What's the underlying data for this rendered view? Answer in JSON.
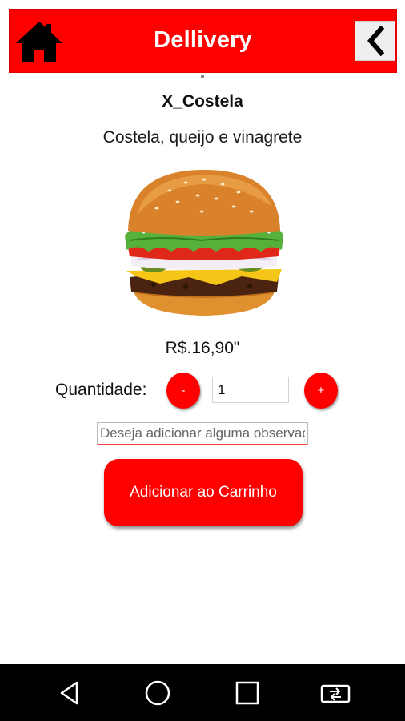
{
  "app_bar": {
    "title": "Dellivery",
    "home_icon": "home-icon",
    "back_icon": "chevron-left-icon",
    "color": "#ff0000"
  },
  "product": {
    "name": "X_Costela",
    "description": "Costela, queijo e vinagrete",
    "image": "burger-image",
    "price": "R$.16,90\""
  },
  "quantity": {
    "label": "Quantidade:",
    "minus_label": "-",
    "value": "1",
    "plus_label": "+"
  },
  "observation": {
    "placeholder": "Deseja adicionar alguma observação?"
  },
  "add_to_cart": {
    "label": "Adicionar ao Carrinho"
  },
  "nav_bar": {
    "icons": [
      "back-triangle-icon",
      "home-circle-icon",
      "recents-square-icon",
      "screen-rotate-icon"
    ]
  }
}
